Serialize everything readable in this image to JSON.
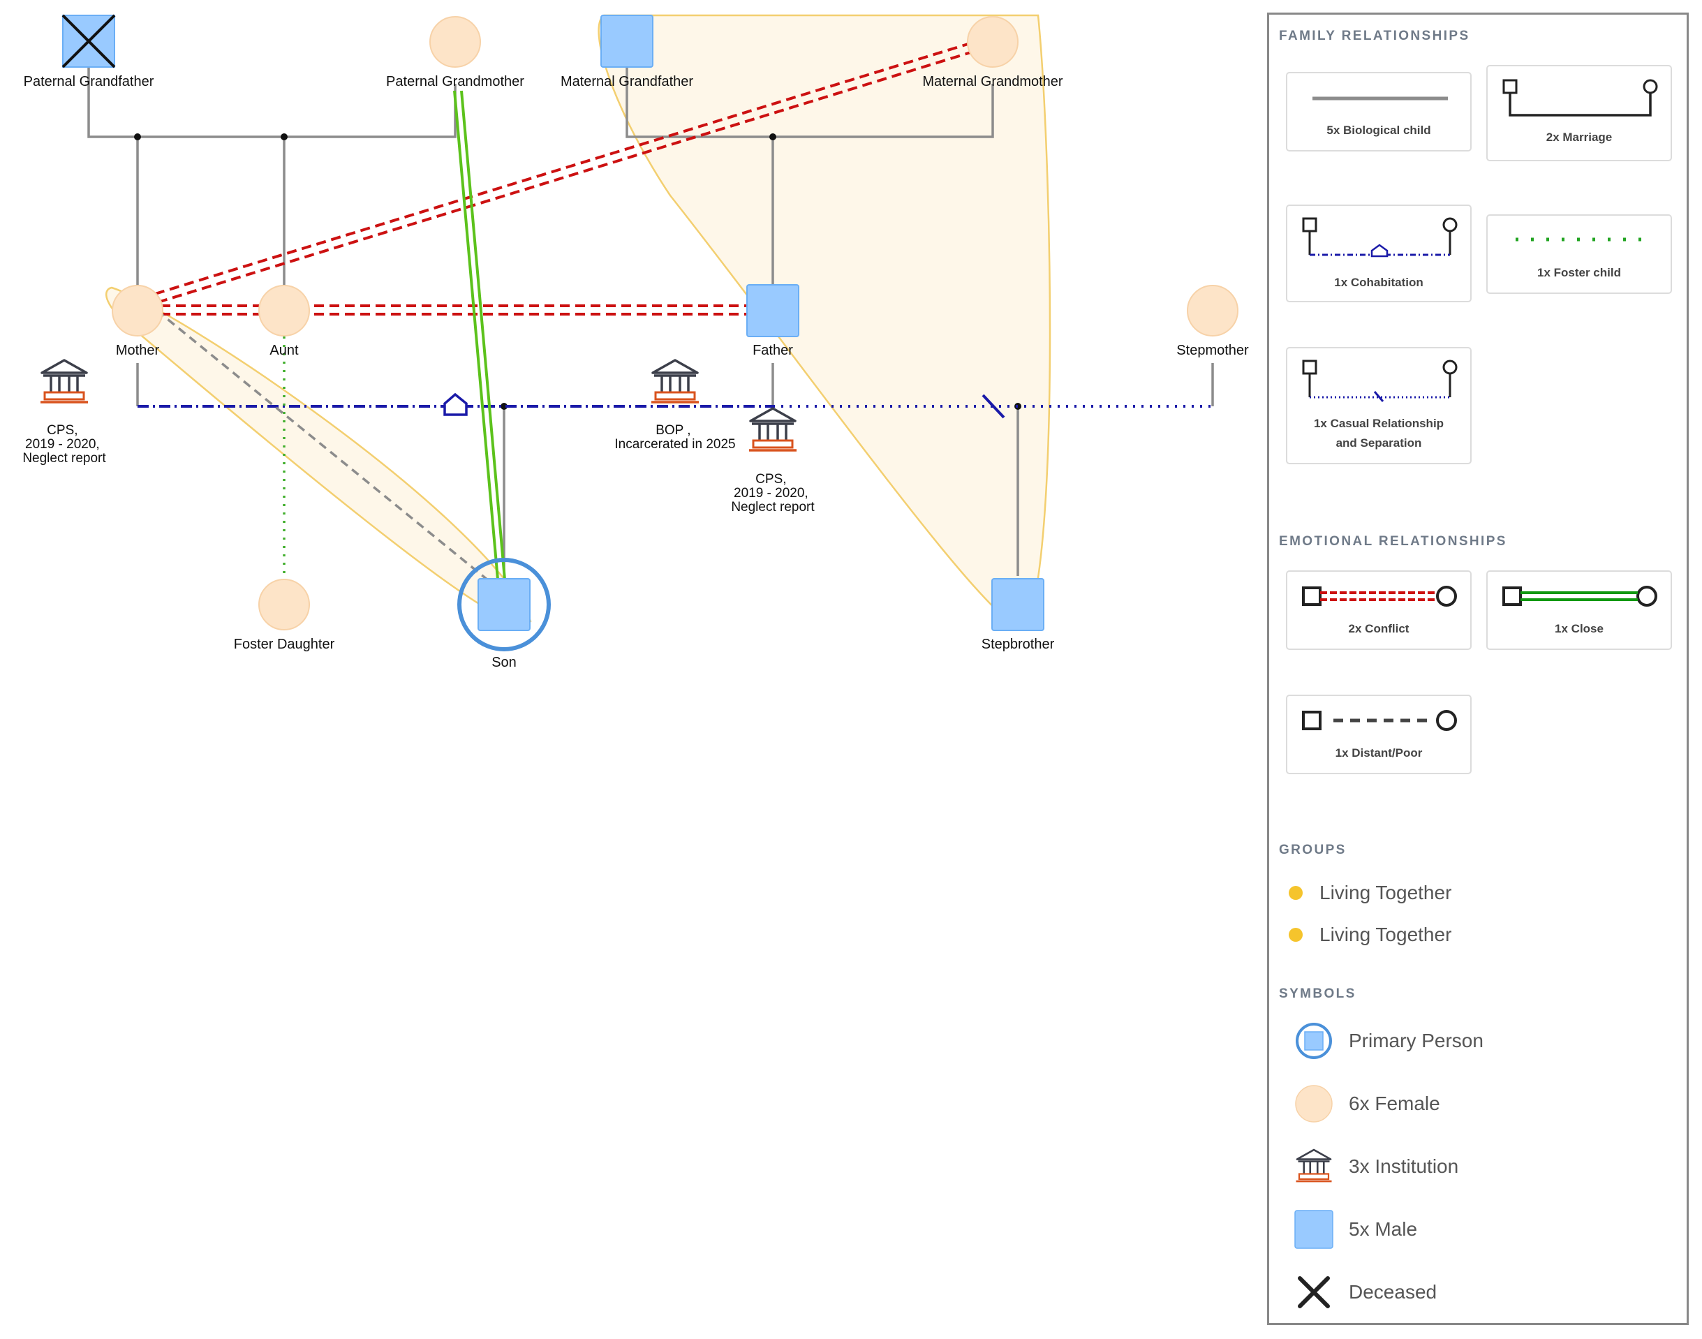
{
  "people": {
    "paternal_grandfather": "Paternal Grandfather",
    "paternal_grandmother": "Paternal Grandmother",
    "maternal_grandfather": "Maternal Grandfather",
    "maternal_grandmother": "Maternal Grandmother",
    "mother": "Mother",
    "aunt": "Aunt",
    "father": "Father",
    "stepmother": "Stepmother",
    "foster_daughter": "Foster Daughter",
    "son": "Son",
    "stepbrother": "Stepbrother"
  },
  "institutions": {
    "mother_cps": [
      "CPS,",
      "2019 - 2020,",
      "Neglect report"
    ],
    "father_bop": [
      "BOP ,",
      "Incarcerated in 2025"
    ],
    "father_cps": [
      "CPS,",
      "2019 - 2020,",
      "Neglect report"
    ]
  },
  "legend": {
    "family_title": "FAMILY RELATIONSHIPS",
    "family_cards": {
      "biological": "5x Biological child",
      "marriage": "2x Marriage",
      "cohabitation": "1x Cohabitation",
      "foster": "1x Foster child",
      "casual_1": "1x Casual Relationship",
      "casual_2": "and Separation"
    },
    "emotional_title": "EMOTIONAL RELATIONSHIPS",
    "emotional_cards": {
      "conflict": "2x Conflict",
      "close": "1x Close",
      "distant": "1x Distant/Poor"
    },
    "groups_title": "GROUPS",
    "groups": [
      "Living Together",
      "Living Together"
    ],
    "symbols_title": "SYMBOLS",
    "symbols": {
      "primary": "Primary Person",
      "female": "6x Female",
      "institution": "3x Institution",
      "male": "5x Male",
      "deceased": "Deceased"
    }
  },
  "colors": {
    "male_fill": "#99caff",
    "female_fill": "#fde4c8",
    "line_gray": "#8c8c8c",
    "conflict_red": "#cc1111",
    "close_green": "#5cc21c",
    "cohab_blue": "#1a1aa8",
    "foster_green": "#3fae2a",
    "group_yellow": "#f5c42c",
    "primary_ring": "#4a90d9",
    "institution_red": "#d9531e",
    "institution_dark": "#3c3f4a"
  }
}
